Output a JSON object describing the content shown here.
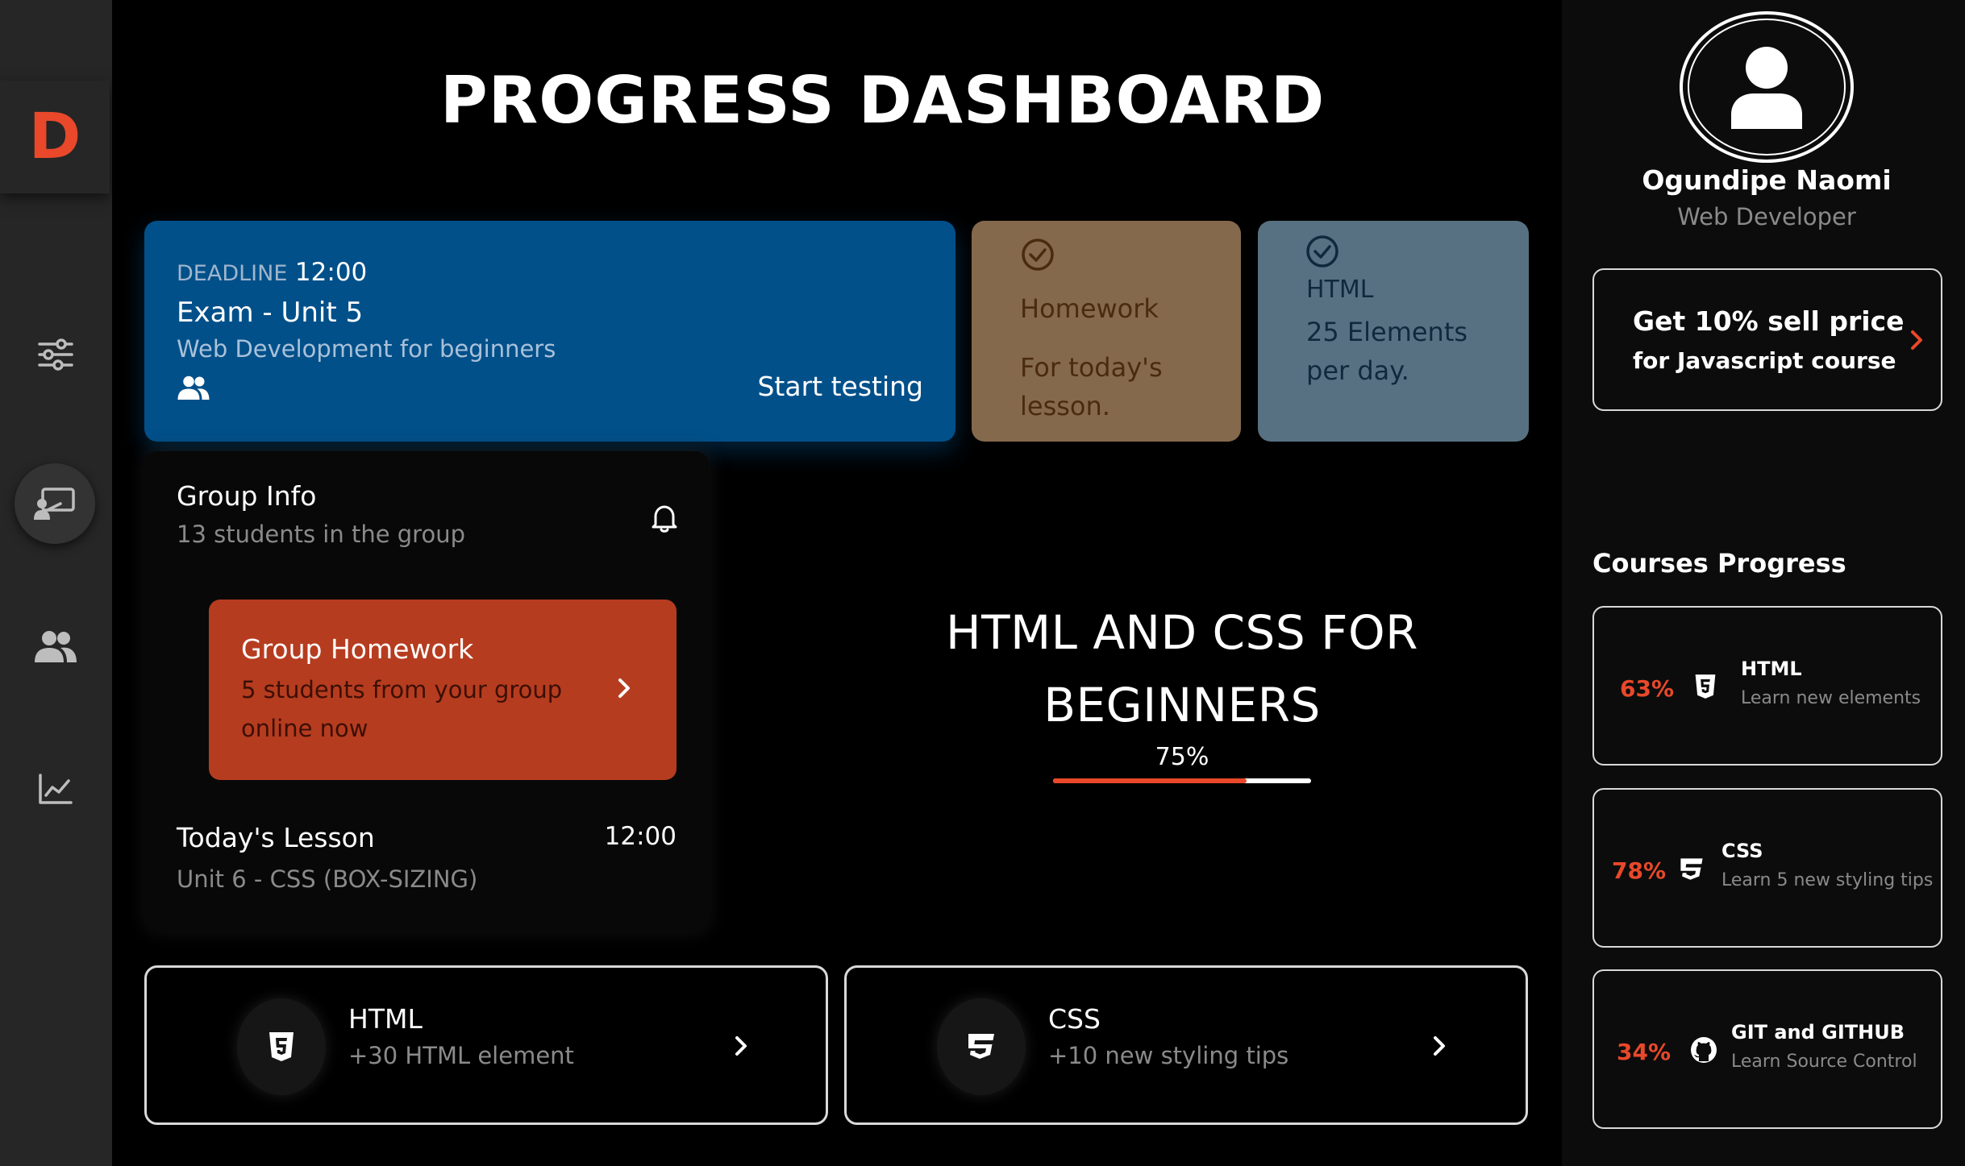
{
  "brand": {
    "logo_letter": "D",
    "accent_color": "#e9482a"
  },
  "sidebar": {
    "items": [
      {
        "name": "filters",
        "icon": "sliders-icon"
      },
      {
        "name": "classroom",
        "icon": "teacher-board-icon",
        "active": true
      },
      {
        "name": "users",
        "icon": "users-icon"
      },
      {
        "name": "stats",
        "icon": "chart-line-icon"
      }
    ]
  },
  "header": {
    "title": "PROGRESS DASHBOARD"
  },
  "deadline_card": {
    "label": "DEADLINE",
    "time": "12:00",
    "title": "Exam - Unit 5",
    "subtitle": "Web Development for beginners",
    "action": "Start testing",
    "color": "#02508a"
  },
  "homework_card": {
    "title": "Homework",
    "text": "For today's lesson.",
    "color": "#85694d"
  },
  "html_card": {
    "title": "HTML",
    "text": "25 Elements per day.",
    "color": "#587182"
  },
  "group_info": {
    "title": "Group Info",
    "subtitle": "13 students in the group",
    "homework": {
      "title": "Group Homework",
      "text": "5 students from your group online now",
      "color": "#b63c1f"
    },
    "lesson": {
      "title": "Today's Lesson",
      "time": "12:00",
      "subtitle": "Unit 6 - CSS (BOX-SIZING)"
    }
  },
  "course": {
    "title_line1": "HTML AND CSS FOR",
    "title_line2": "BEGINNERS",
    "percent_label": "75%",
    "progress": 0.75
  },
  "bottom_cards": [
    {
      "title": "HTML",
      "subtitle": "+30 HTML element",
      "icon": "html5-icon"
    },
    {
      "title": "CSS",
      "subtitle": "+10 new styling tips",
      "icon": "css3-icon"
    }
  ],
  "profile": {
    "name": "Ogundipe Naomi",
    "role": "Web Developer"
  },
  "promo": {
    "title": "Get 10% sell price",
    "subtitle": "for Javascript course"
  },
  "courses_progress": {
    "title": "Courses Progress",
    "items": [
      {
        "percent": "63%",
        "name": "HTML",
        "subtitle": "Learn new elements",
        "icon": "html5-icon"
      },
      {
        "percent": "78%",
        "name": "CSS",
        "subtitle": "Learn 5 new styling tips",
        "icon": "css3-icon"
      },
      {
        "percent": "34%",
        "name": "GIT and GITHUB",
        "subtitle": "Learn Source Control",
        "icon": "github-icon"
      }
    ]
  }
}
